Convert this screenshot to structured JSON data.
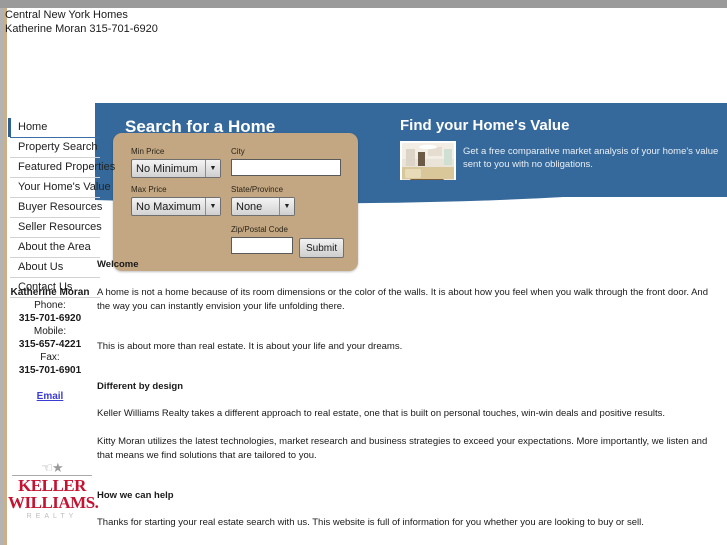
{
  "header": {
    "line1": "Central New York Homes",
    "line2": "Katherine Moran 315-701-6920"
  },
  "sidebar": {
    "nav": [
      {
        "label": "Home",
        "active": true
      },
      {
        "label": "Property Search",
        "active": false
      },
      {
        "label": "Featured Properties",
        "active": false
      },
      {
        "label": "Your Home's Value",
        "active": false
      },
      {
        "label": "Buyer Resources",
        "active": false
      },
      {
        "label": "Seller Resources",
        "active": false
      },
      {
        "label": "About the Area",
        "active": false
      },
      {
        "label": "About Us",
        "active": false
      },
      {
        "label": "Contact Us",
        "active": false
      }
    ],
    "agent": {
      "name": "Katherine Moran",
      "phone_label": "Phone:",
      "phone": "315-701-6920",
      "mobile_label": "Mobile:",
      "mobile": "315-657-4221",
      "fax_label": "Fax:",
      "fax": "315-701-6901",
      "email_link": "Email"
    },
    "logo": {
      "line1": "KELLER",
      "line2": "WILLIAMS.",
      "line3": "REALTY"
    }
  },
  "banner": {
    "search_title": "Search for a Home",
    "home_value_title": "Find your Home's Value",
    "home_value_text": "Get a free comparative market analysis of your home's value sent to you with no obligations."
  },
  "search_form": {
    "min_price_label": "Min Price",
    "min_price_value": "No Minimum",
    "max_price_label": "Max Price",
    "max_price_value": "No Maximum",
    "city_label": "City",
    "city_value": "",
    "state_label": "State/Province",
    "state_value": "None",
    "zip_label": "Zip/Postal Code",
    "zip_value": "",
    "submit_label": "Submit"
  },
  "content": {
    "welcome_heading": "Welcome",
    "p1": "A home is not a home because of its room dimensions or the color of the walls. It is about how you feel when you walk through the front door. And the way you can instantly envision your life unfolding there.",
    "p2": "This is about more than real estate. It is about your life and your dreams.",
    "head2": "Different by design",
    "p3": "Keller Williams Realty takes a different approach to real estate, one that is built on personal touches, win-win deals and positive results.",
    "p4": "Kitty Moran utilizes the latest technologies, market research and business strategies to exceed your expectations. More importantly, we listen and that means we find solutions that are tailored to you.",
    "head3": "How we can help",
    "p5": "Thanks for starting your real estate search with us. This website is full of information for you whether you are looking to buy or sell."
  },
  "colors": {
    "banner_blue": "#35699b",
    "panel_tan": "#c2a782",
    "accent_blue": "#2f6096",
    "logo_red": "#c41230",
    "link_blue": "#3b3bd6",
    "topbar_gray": "#9a9a9a"
  }
}
